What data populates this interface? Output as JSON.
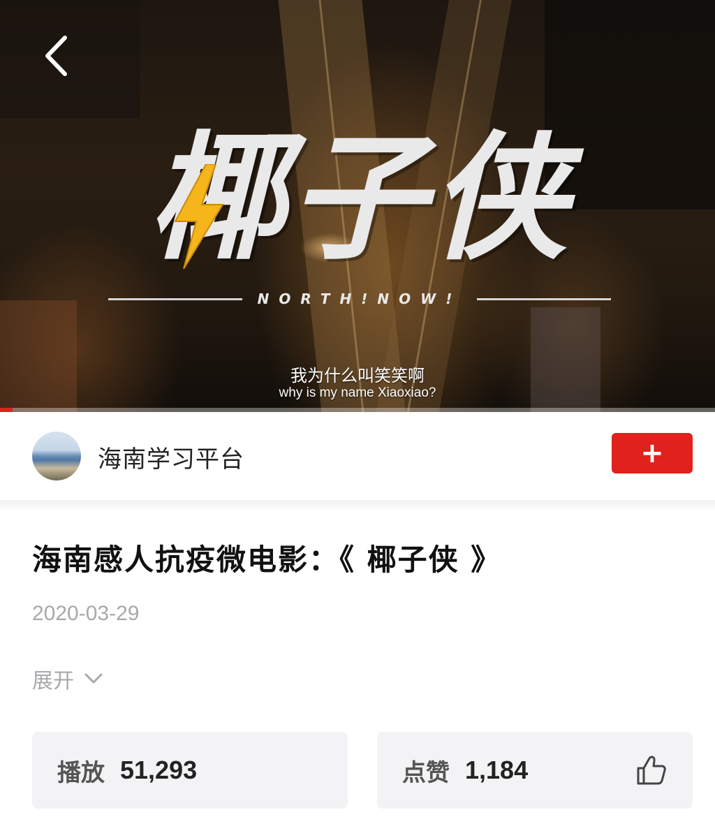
{
  "player": {
    "logo_title": "椰子侠",
    "logo_subtitle": "NORTH!NOW!",
    "subtitle_zh": "我为什么叫笑笑啊",
    "subtitle_en": "why is my name Xiaoxiao?",
    "progress_fraction": 0.018,
    "back_icon": "chevron-left-icon"
  },
  "channel": {
    "name": "海南学习平台",
    "follow_label": "+"
  },
  "video": {
    "title": "海南感人抗疫微电影：《 椰子侠 》",
    "date": "2020-03-29",
    "expand_label": "展开"
  },
  "stats": {
    "plays_label": "播放",
    "plays_value": "51,293",
    "likes_label": "点赞",
    "likes_value": "1,184"
  },
  "colors": {
    "accent": "#e0211c",
    "muted_text": "#a8a8ad",
    "card_bg": "#f3f3f5"
  }
}
